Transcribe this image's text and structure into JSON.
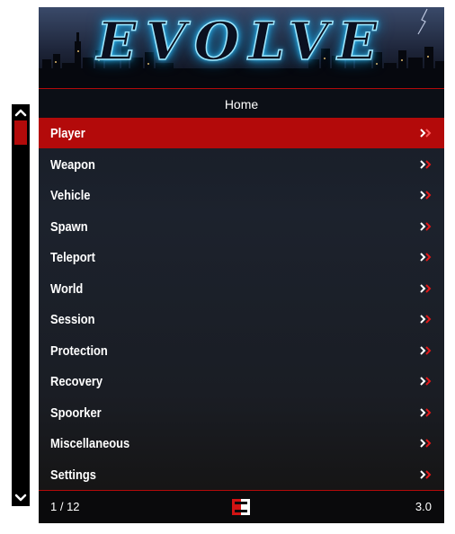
{
  "banner": {
    "title": "EVOLVE"
  },
  "header": {
    "title": "Home"
  },
  "menu": {
    "selected_index": 0,
    "items": [
      {
        "label": "Player"
      },
      {
        "label": "Weapon"
      },
      {
        "label": "Vehicle"
      },
      {
        "label": "Spawn"
      },
      {
        "label": "Teleport"
      },
      {
        "label": "World"
      },
      {
        "label": "Session"
      },
      {
        "label": "Protection"
      },
      {
        "label": "Recovery"
      },
      {
        "label": "Spoorker"
      },
      {
        "label": "Miscellaneous"
      },
      {
        "label": "Settings"
      }
    ]
  },
  "footer": {
    "page_indicator": "1 / 12",
    "version": "3.0",
    "logo_icon": "evolve-logo-icon"
  },
  "colors": {
    "accent": "#b30a0a",
    "title_glow": "#38c8ff"
  }
}
